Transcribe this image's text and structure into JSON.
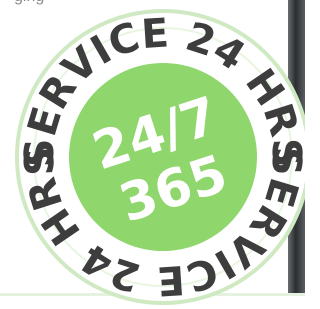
{
  "top_fragment": "ging",
  "badge": {
    "ring_top": "SERVICE 24 HRS",
    "ring_bottom": "SERVICE 24 HRS",
    "center_line1": "24/7",
    "center_line2": "365",
    "colors": {
      "ring_fill": "#ffffff",
      "ring_outline": "#cfe9c3",
      "ring_text": "#3d3d3d",
      "center_fill": "#8fd66d",
      "center_text": "#ffffff"
    }
  }
}
